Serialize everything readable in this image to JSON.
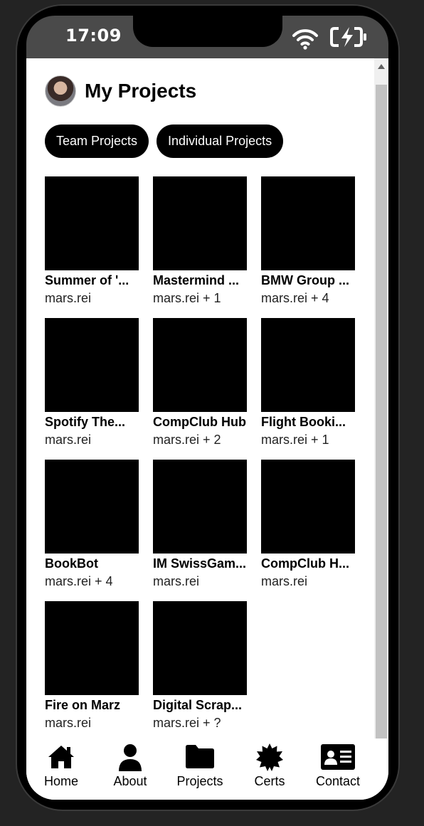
{
  "status": {
    "time": "17:09"
  },
  "header": {
    "title": "My Projects"
  },
  "tabs": [
    {
      "label": "Team Projects"
    },
    {
      "label": "Individual Projects"
    }
  ],
  "projects": [
    {
      "title": "Summer of '...",
      "owner": "mars.rei"
    },
    {
      "title": "Mastermind ...",
      "owner": "mars.rei + 1"
    },
    {
      "title": "BMW Group ...",
      "owner": "mars.rei + 4"
    },
    {
      "title": "Spotify The...",
      "owner": "mars.rei"
    },
    {
      "title": "CompClub Hub",
      "owner": "mars.rei + 2"
    },
    {
      "title": "Flight Booki...",
      "owner": "mars.rei + 1"
    },
    {
      "title": "BookBot",
      "owner": "mars.rei + 4"
    },
    {
      "title": "IM SwissGam...",
      "owner": "mars.rei"
    },
    {
      "title": "CompClub H...",
      "owner": "mars.rei"
    },
    {
      "title": "Fire on Marz",
      "owner": "mars.rei"
    },
    {
      "title": "Digital Scrap...",
      "owner": "mars.rei + ?"
    }
  ],
  "nav": {
    "items": [
      {
        "label": "Home",
        "icon": "home-icon"
      },
      {
        "label": "About",
        "icon": "user-icon"
      },
      {
        "label": "Projects",
        "icon": "folder-icon"
      },
      {
        "label": "Certs",
        "icon": "certificate-icon"
      },
      {
        "label": "Contact",
        "icon": "contact-card-icon"
      }
    ]
  }
}
